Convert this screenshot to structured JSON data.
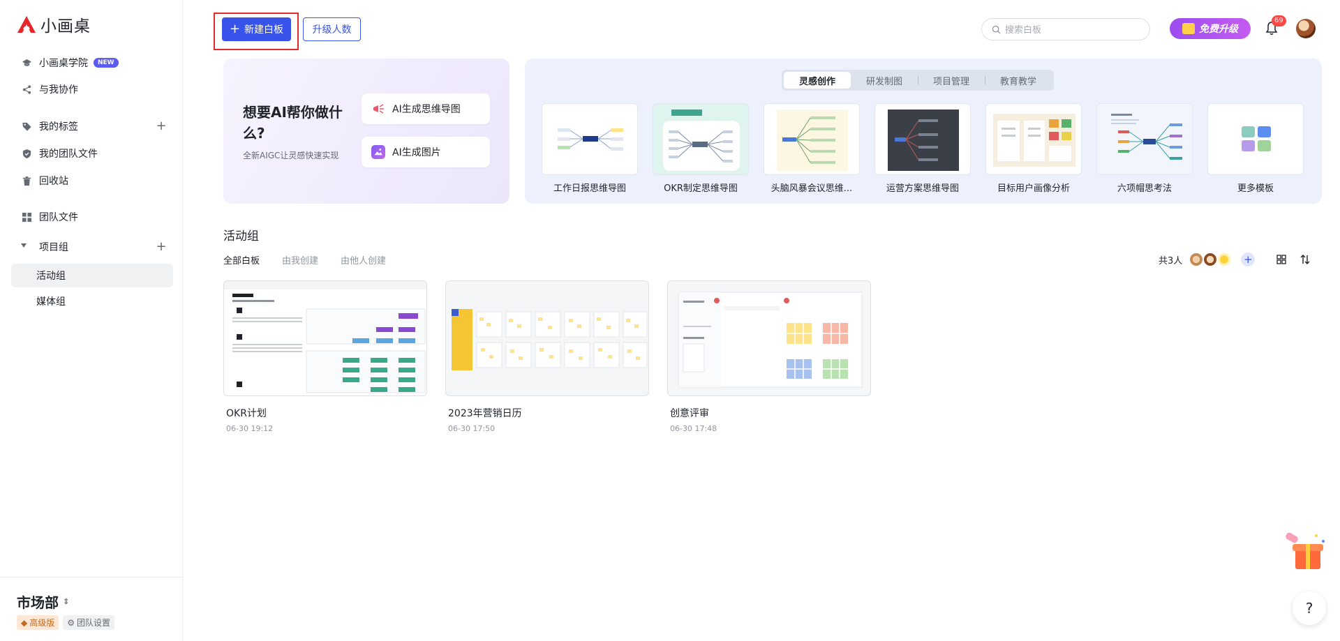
{
  "app": {
    "name": "小画桌"
  },
  "sidebar": {
    "items": [
      {
        "label": "小画桌学院",
        "badge": "NEW"
      },
      {
        "label": "与我协作"
      },
      {
        "label": "我的标签"
      },
      {
        "label": "我的团队文件"
      },
      {
        "label": "回收站"
      },
      {
        "label": "团队文件"
      },
      {
        "label": "项目组"
      },
      {
        "label": "活动组"
      },
      {
        "label": "媒体组"
      }
    ],
    "team": {
      "name": "市场部",
      "plan": "高级版",
      "settings": "团队设置"
    }
  },
  "toolbar": {
    "new_board": "新建白板",
    "upgrade_seats": "升级人数",
    "search_placeholder": "搜索白板",
    "free_upgrade": "免费升级",
    "notification_count": "69"
  },
  "ai_banner": {
    "title": "想要AI帮你做什么?",
    "subtitle": "全新AIGC让灵感快速实现",
    "actions": [
      {
        "label": "AI生成思维导图"
      },
      {
        "label": "AI生成图片"
      }
    ]
  },
  "templates": {
    "tabs": [
      "灵感创作",
      "研发制图",
      "项目管理",
      "教育教学"
    ],
    "active_tab": "灵感创作",
    "items": [
      {
        "label": "工作日报思维导图"
      },
      {
        "label": "OKR制定思维导图"
      },
      {
        "label": "头脑风暴会议思维..."
      },
      {
        "label": "运营方案思维导图"
      },
      {
        "label": "目标用户画像分析"
      },
      {
        "label": "六项帽思考法"
      },
      {
        "label": "更多模板"
      }
    ]
  },
  "section": {
    "title": "活动组",
    "filters": [
      "全部白板",
      "由我创建",
      "由他人创建"
    ],
    "member_count": "共3人"
  },
  "boards": [
    {
      "name": "OKR计划",
      "date": "06-30 19:12"
    },
    {
      "name": "2023年营销日历",
      "date": "06-30 17:50"
    },
    {
      "name": "创意评审",
      "date": "06-30 17:48"
    }
  ],
  "help": {
    "label": "?"
  },
  "colors": {
    "primary": "#3853ea",
    "highlight_box": "#e5282b",
    "upgrade": "#9b4cf0"
  }
}
